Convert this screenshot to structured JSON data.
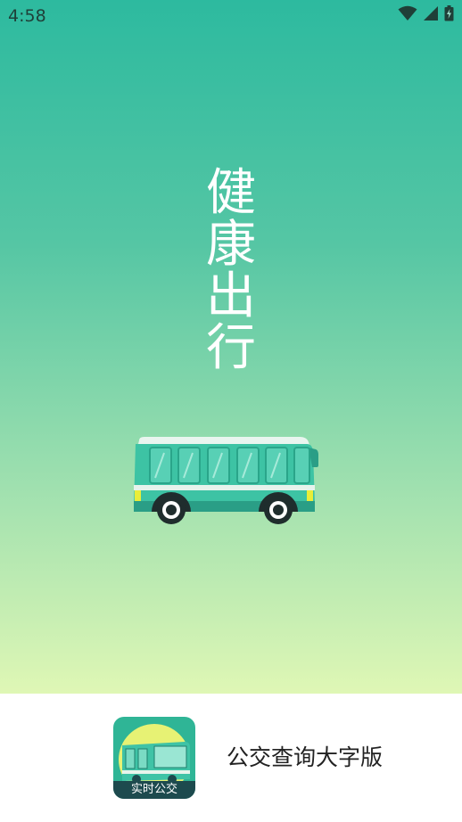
{
  "status_bar": {
    "time": "4:58",
    "icons": [
      "wifi-icon",
      "cell-signal-icon",
      "battery-charging-icon"
    ]
  },
  "splash": {
    "slogan_chars": [
      "健",
      "康",
      "出",
      "行"
    ],
    "illustration": "bus-illustration"
  },
  "footer": {
    "app_icon_label": "实时公交",
    "app_name": "公交查询大字版"
  },
  "colors": {
    "gradient_top": "#2dba9f",
    "gradient_bottom": "#dff7b5",
    "bus_body": "#3dc3a4",
    "footer_bg": "#ffffff"
  }
}
